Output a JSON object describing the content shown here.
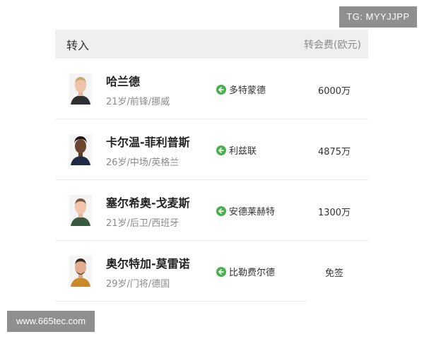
{
  "watermarks": {
    "top_right": "TG: MYYJJPP",
    "bottom_left": "www.665tec.com"
  },
  "table": {
    "header_left": "转入",
    "header_right": "转会费(欧元)"
  },
  "transfers": [
    {
      "name": "哈兰德",
      "info": "21岁/前锋/挪威",
      "club": "多特蒙德",
      "fee": "6000万",
      "direction_icon": "arrow-left-icon"
    },
    {
      "name": "卡尔温-菲利普斯",
      "info": "26岁/中场/英格兰",
      "club": "利兹联",
      "fee": "4875万",
      "direction_icon": "arrow-left-icon"
    },
    {
      "name": "塞尔希奥-戈麦斯",
      "info": "21岁/后卫/西班牙",
      "club": "安德莱赫特",
      "fee": "1300万",
      "direction_icon": "arrow-left-icon"
    },
    {
      "name": "奥尔特加-莫雷诺",
      "info": "29岁/门将/德国",
      "club": "比勒费尔德",
      "fee": "免签",
      "direction_icon": "arrow-left-icon"
    }
  ],
  "colors": {
    "accent_green": "#49b04d",
    "header_bg": "#efefef"
  }
}
